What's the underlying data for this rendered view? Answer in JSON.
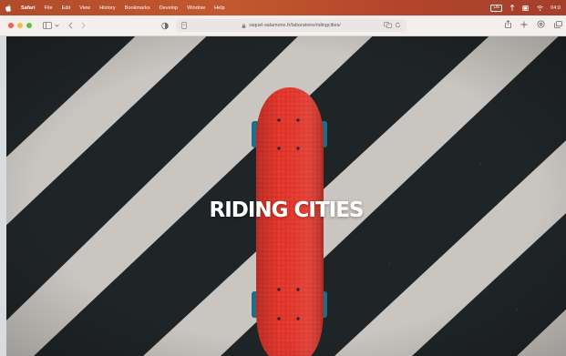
{
  "menubar": {
    "app_name": "Safari",
    "items": [
      "File",
      "Edit",
      "View",
      "History",
      "Bookmarks",
      "Develop",
      "Window",
      "Help"
    ],
    "input_source": "US",
    "clock": "04:0"
  },
  "toolbar": {
    "url": "raquel-salamone.fr/laboratoire/ridingcities/"
  },
  "hero": {
    "title": "RIDING CITIES"
  },
  "colors": {
    "menubar_accent": "#b4452b",
    "asphalt": "#1f2426",
    "stripe": "#c9c6c1",
    "deck": "#e2372c",
    "wheels": "#1d6e8a"
  }
}
